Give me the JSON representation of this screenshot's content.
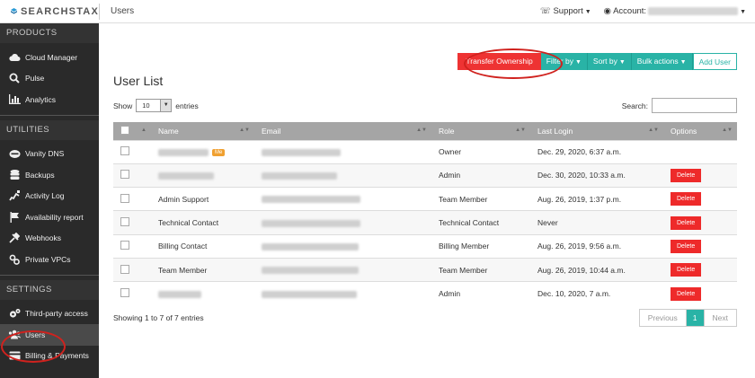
{
  "topbar": {
    "brand": "SEARCHSTAX",
    "page_title": "Users",
    "support_label": "Support",
    "account_label": "Account:"
  },
  "sidebar": {
    "sections": [
      {
        "title": "PRODUCTS",
        "items": [
          {
            "label": "Cloud Manager",
            "icon": "cloud-icon"
          },
          {
            "label": "Pulse",
            "icon": "search-icon"
          },
          {
            "label": "Analytics",
            "icon": "bar-chart-icon"
          }
        ]
      },
      {
        "title": "UTILITIES",
        "items": [
          {
            "label": "Vanity DNS",
            "icon": "dns-icon"
          },
          {
            "label": "Backups",
            "icon": "database-icon"
          },
          {
            "label": "Activity Log",
            "icon": "activity-icon"
          },
          {
            "label": "Availability report",
            "icon": "flag-icon"
          },
          {
            "label": "Webhooks",
            "icon": "webhook-icon"
          },
          {
            "label": "Private VPCs",
            "icon": "vpc-icon"
          }
        ]
      },
      {
        "title": "SETTINGS",
        "items": [
          {
            "label": "Third-party access",
            "icon": "cogs-icon"
          },
          {
            "label": "Users",
            "icon": "users-icon",
            "active": true
          },
          {
            "label": "Billing & Payments",
            "icon": "credit-card-icon"
          }
        ]
      }
    ]
  },
  "toolbar": {
    "transfer_label": "Transfer Ownership",
    "filter_label": "Filter by",
    "sort_label": "Sort by",
    "bulk_label": "Bulk actions",
    "add_label": "Add User"
  },
  "list": {
    "title": "User List",
    "show_label": "Show",
    "entries_value": "10",
    "entries_label": "entries",
    "search_label": "Search:",
    "columns": [
      "Name",
      "Email",
      "Role",
      "Last Login",
      "Options"
    ],
    "me_badge": "Me",
    "delete_label": "Delete",
    "rows": [
      {
        "name": "",
        "name_hidden": true,
        "me": true,
        "role": "Owner",
        "last_login": "Dec. 29, 2020, 6:37 a.m.",
        "deletable": false
      },
      {
        "name": "",
        "name_hidden": true,
        "me": false,
        "role": "Admin",
        "last_login": "Dec. 30, 2020, 10:33 a.m.",
        "deletable": true
      },
      {
        "name": "Admin Support",
        "name_hidden": false,
        "me": false,
        "role": "Team Member",
        "last_login": "Aug. 26, 2019, 1:37 p.m.",
        "deletable": true
      },
      {
        "name": "Technical Contact",
        "name_hidden": false,
        "me": false,
        "role": "Technical Contact",
        "last_login": "Never",
        "deletable": true
      },
      {
        "name": "Billing Contact",
        "name_hidden": false,
        "me": false,
        "role": "Billing Member",
        "last_login": "Aug. 26, 2019, 9:56 a.m.",
        "deletable": true
      },
      {
        "name": "Team Member",
        "name_hidden": false,
        "me": false,
        "role": "Team Member",
        "last_login": "Aug. 26, 2019, 10:44 a.m.",
        "deletable": true
      },
      {
        "name": "",
        "name_hidden": true,
        "me": false,
        "role": "Admin",
        "last_login": "Dec. 10, 2020, 7 a.m.",
        "deletable": true
      }
    ],
    "footer_info": "Showing 1 to 7 of 7 entries",
    "pager": {
      "prev": "Previous",
      "current": "1",
      "next": "Next"
    }
  },
  "colors": {
    "accent": "#29b3a6",
    "danger": "#ee3333",
    "sidebar_bg": "#2a2a2a",
    "highlight_oval": "#d0221e"
  }
}
